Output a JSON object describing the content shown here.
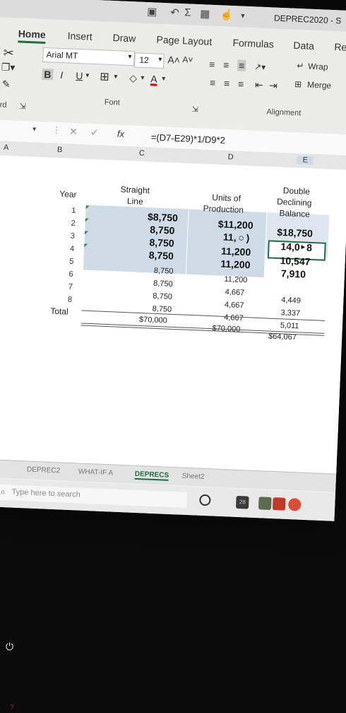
{
  "window": {
    "title": "DEPREC2020 - S"
  },
  "ribbon": {
    "tabs": [
      "Home",
      "Insert",
      "Draw",
      "Page Layout",
      "Formulas",
      "Data",
      "Re"
    ],
    "font_name": "Arial MT",
    "font_size": "12",
    "bold": "B",
    "italic": "I",
    "underline": "U",
    "grow": "A˄",
    "shrink": "A˅",
    "font_color": "A",
    "wrap_label": "Wrap",
    "merge_label": "Merge",
    "group_font": "Font",
    "group_alignment": "Alignment",
    "group_clipboard": "oard",
    "left_cut": "e"
  },
  "formula_bar": {
    "fx": "fx",
    "formula": "=(D7-E29)*1/D9*2"
  },
  "columns": [
    "A",
    "B",
    "C",
    "D",
    "E"
  ],
  "sheet": {
    "headers": {
      "year": "Year",
      "c1": "Straight",
      "c2": "Line",
      "d1": "Units of",
      "d2": "Production",
      "e1": "Double",
      "e2": "Declining",
      "e3": "Balance"
    },
    "rows": [
      {
        "year": "1",
        "c": "$8,750",
        "d": "$11,200",
        "e": "$18,750"
      },
      {
        "year": "2",
        "c": "8,750",
        "d": "11, ○ )",
        "e": "14,0‣ 8"
      },
      {
        "year": "3",
        "c": "8,750",
        "d": "11,200",
        "e": "10,547"
      },
      {
        "year": "4",
        "c": "8,750",
        "d": "11,200",
        "e": "7,910"
      },
      {
        "year": "5",
        "c": "8,750",
        "d": "11,200",
        "e": ""
      },
      {
        "year": "6",
        "c": "8,750",
        "d": "4,667",
        "e": "4,449"
      },
      {
        "year": "7",
        "c": "8,750",
        "d": "4,667",
        "e": "3,337"
      },
      {
        "year": "8",
        "c": "8,750",
        "d": "4,667",
        "e": "5,011"
      }
    ],
    "total": {
      "label": "Total",
      "c": "$70,000",
      "d": "$70,000",
      "e": "$64,067"
    }
  },
  "sheet_tabs": [
    "DEPREC2",
    "WHAT-IF A",
    "DEPRECS",
    "Sheet2"
  ],
  "active_sheet": "DEPRECS",
  "taskbar": {
    "search_placeholder": "Type here to search",
    "badge": "28"
  },
  "colors": {
    "accent": "#1d6f42",
    "selection": "#cfdbe6"
  }
}
